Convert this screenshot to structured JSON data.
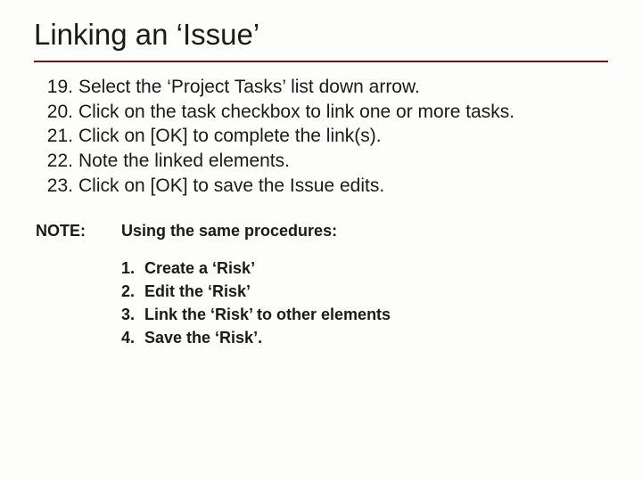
{
  "title": "Linking an ‘Issue’",
  "steps": [
    {
      "n": "19.",
      "t": "Select the ‘Project Tasks’ list down arrow."
    },
    {
      "n": "20.",
      "t": "Click on the task checkbox to link one or more tasks."
    },
    {
      "n": "21.",
      "t": "Click on [OK] to complete the link(s)."
    },
    {
      "n": "22.",
      "t": "Note the linked elements."
    },
    {
      "n": "23.",
      "t": "Click on [OK] to save the Issue edits."
    }
  ],
  "note_label": "NOTE:",
  "note_text": "Using the same procedures:",
  "substeps": [
    {
      "n": "1.",
      "t": "Create a ‘Risk’"
    },
    {
      "n": "2.",
      "t": "Edit the ‘Risk’"
    },
    {
      "n": "3.",
      "t": "Link the ‘Risk’ to other elements"
    },
    {
      "n": "4.",
      "t": "Save the ‘Risk’."
    }
  ]
}
